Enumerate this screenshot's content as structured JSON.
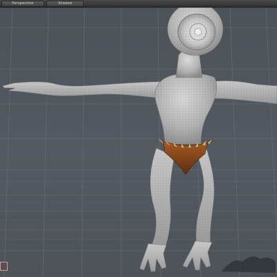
{
  "viewport": {
    "view_mode": "Perspective",
    "shading_mode": "Shaded",
    "background_color": "#4f565d",
    "grid_color": "#5f676e",
    "model_color": "#b9b9b9",
    "loincloth_color": "#8a4a1f",
    "spike_color": "#d8b45a"
  },
  "icons": {
    "corner_widget": "axis-icon",
    "bottom_logo": "logo-icon"
  }
}
